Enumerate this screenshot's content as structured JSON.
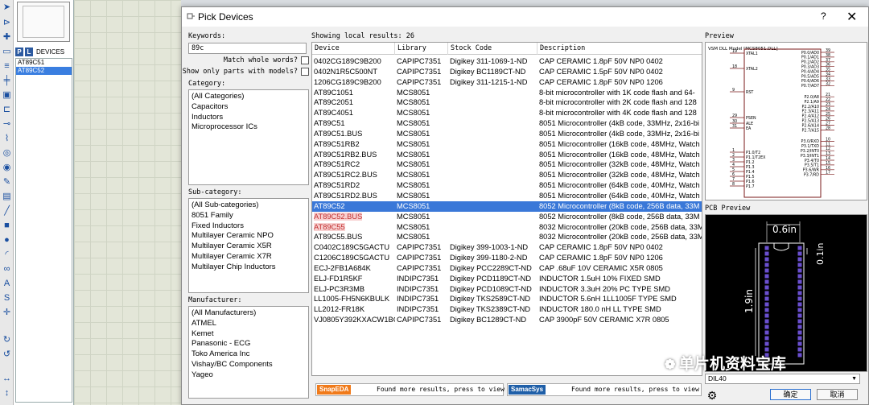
{
  "app": {
    "panel_tabs": [
      "P",
      "L"
    ],
    "devices_label": "DEVICES",
    "device_list": [
      {
        "name": "AT89C51",
        "selected": false
      },
      {
        "name": "AT89C52",
        "selected": true
      }
    ]
  },
  "dialog": {
    "title": "Pick Devices",
    "help": "?",
    "close": "✕",
    "keywords_label": "Keywords:",
    "keywords_value": "89c",
    "match_whole_words": "Match whole words?",
    "show_only_models": "Show only parts with models?",
    "category_label": "Category:",
    "categories": [
      "(All Categories)",
      "Capacitors",
      "Inductors",
      "Microprocessor ICs"
    ],
    "subcategory_label": "Sub-category:",
    "subcategories": [
      "(All Sub-categories)",
      "8051 Family",
      "Fixed Inductors",
      "Multilayer Ceramic NPO",
      "Multilayer Ceramic X5R",
      "Multilayer Ceramic X7R",
      "Multilayer Chip Inductors"
    ],
    "manufacturer_label": "Manufacturer:",
    "manufacturers": [
      "(All Manufacturers)",
      "ATMEL",
      "Kemet",
      "Panasonic - ECG",
      "Toko America Inc",
      "Vishay/BC Components",
      "Yageo"
    ],
    "results_summary": "Showing local results: 26",
    "columns": [
      "Device",
      "Library",
      "Stock Code",
      "Description"
    ],
    "results": [
      {
        "device": "0402CG189C9B200",
        "library": "CAPIPC7351",
        "stock": "Digikey 311-1069-1-ND",
        "desc": "CAP CERAMIC 1.8pF 50V NP0 0402"
      },
      {
        "device": "0402N1R5C500NT",
        "library": "CAPIPC7351",
        "stock": "Digikey BC1189CT-ND",
        "desc": "CAP CERAMIC 1.5pF 50V NP0 0402"
      },
      {
        "device": "1206CG189C9B200",
        "library": "CAPIPC7351",
        "stock": "Digikey 311-1215-1-ND",
        "desc": "CAP CERAMIC 1.8pF 50V NP0 1206"
      },
      {
        "device": "AT89C1051",
        "library": "MCS8051",
        "stock": "",
        "desc": "8-bit microcontroller with 1K code flash and 64-"
      },
      {
        "device": "AT89C2051",
        "library": "MCS8051",
        "stock": "",
        "desc": "8-bit microcontroller with 2K code flash and 128"
      },
      {
        "device": "AT89C4051",
        "library": "MCS8051",
        "stock": "",
        "desc": "8-bit microcontroller with 4K code flash and 128"
      },
      {
        "device": "AT89C51",
        "library": "MCS8051",
        "stock": "",
        "desc": "8051 Microcontroller (4kB code, 33MHz, 2x16-bi"
      },
      {
        "device": "AT89C51.BUS",
        "library": "MCS8051",
        "stock": "",
        "desc": "8051 Microcontroller (4kB code, 33MHz, 2x16-bi"
      },
      {
        "device": "AT89C51RB2",
        "library": "MCS8051",
        "stock": "",
        "desc": "8051 Microcontroller (16kB code, 48MHz, Watch"
      },
      {
        "device": "AT89C51RB2.BUS",
        "library": "MCS8051",
        "stock": "",
        "desc": "8051 Microcontroller (16kB code, 48MHz, Watch"
      },
      {
        "device": "AT89C51RC2",
        "library": "MCS8051",
        "stock": "",
        "desc": "8051 Microcontroller (32kB code, 48MHz, Watch"
      },
      {
        "device": "AT89C51RC2.BUS",
        "library": "MCS8051",
        "stock": "",
        "desc": "8051 Microcontroller (32kB code, 48MHz, Watch"
      },
      {
        "device": "AT89C51RD2",
        "library": "MCS8051",
        "stock": "",
        "desc": "8051 Microcontroller (64kB code, 40MHz, Watch"
      },
      {
        "device": "AT89C51RD2.BUS",
        "library": "MCS8051",
        "stock": "",
        "desc": "8051 Microcontroller (64kB code, 40MHz, Watch"
      },
      {
        "device": "AT89C52",
        "library": "MCS8051",
        "stock": "",
        "desc": "8052 Microcontroller (8kB code, 256B data, 33M",
        "selected": true
      },
      {
        "device": "AT89C52.BUS",
        "library": "MCS8051",
        "stock": "",
        "desc": "8052 Microcontroller (8kB code, 256B data, 33M",
        "highlight": true
      },
      {
        "device": "AT89C55",
        "library": "MCS8051",
        "stock": "",
        "desc": "8032 Microcontroller (20kB code, 256B data, 33M",
        "highlight": true
      },
      {
        "device": "AT89C55.BUS",
        "library": "MCS8051",
        "stock": "",
        "desc": "8032 Microcontroller (20kB code, 256B data, 33M"
      },
      {
        "device": "C0402C189C5GACTU",
        "library": "CAPIPC7351",
        "stock": "Digikey 399-1003-1-ND",
        "desc": "CAP CERAMIC 1.8pF 50V NP0 0402"
      },
      {
        "device": "C1206C189C5GACTU",
        "library": "CAPIPC7351",
        "stock": "Digikey 399-1180-2-ND",
        "desc": "CAP CERAMIC 1.8pF 50V NP0 1206"
      },
      {
        "device": "ECJ-2FB1A684K",
        "library": "CAPIPC7351",
        "stock": "Digikey PCC2289CT-ND",
        "desc": "CAP .68uF 10V CERAMIC X5R 0805"
      },
      {
        "device": "ELJ-FD1R5KF",
        "library": "INDIPC7351",
        "stock": "Digikey PCD1189CT-ND",
        "desc": "INDUCTOR 1.5uH 10% FIXED SMD"
      },
      {
        "device": "ELJ-PC3R3MB",
        "library": "INDIPC7351",
        "stock": "Digikey PCD1089CT-ND",
        "desc": "INDUCTOR 3.3uH 20% PC TYPE SMD"
      },
      {
        "device": "LL1005-FH5N6KBULK",
        "library": "INDIPC7351",
        "stock": "Digikey TKS2589CT-ND",
        "desc": "INDUCTOR 5.6nH 1LL1005F TYPE SMD"
      },
      {
        "device": "LL2012-FR18K",
        "library": "INDIPC7351",
        "stock": "Digikey TKS2389CT-ND",
        "desc": "INDUCTOR 180.0 nH LL TYPE SMD"
      },
      {
        "device": "VJ0805Y392KXACW1BC",
        "library": "CAPIPC7351",
        "stock": "Digikey BC1289CT-ND",
        "desc": "CAP 3900pF 50V CERAMIC X7R 0805"
      }
    ],
    "snapeda_logo": "SnapEDA",
    "snapeda_text": "Found more results, press to view",
    "samacsys_logo": "SamacSys",
    "samacsys_text": "Found more results, press to view",
    "preview_label": "Preview",
    "schematic_title": "VSM DLL Model [MCS8051.DLL]",
    "schematic_left_pins": [
      {
        "num": "19",
        "name": "XTAL1"
      },
      {
        "num": "18",
        "name": "XTAL2"
      },
      {
        "num": "9",
        "name": "RST"
      },
      {
        "num": "29",
        "name": "PSEN"
      },
      {
        "num": "30",
        "name": "ALE"
      },
      {
        "num": "31",
        "name": "EA"
      },
      {
        "num": "1",
        "name": "P1.0/T2"
      },
      {
        "num": "2",
        "name": "P1.1/T2EX"
      },
      {
        "num": "3",
        "name": "P1.2"
      },
      {
        "num": "4",
        "name": "P1.3"
      },
      {
        "num": "5",
        "name": "P1.4"
      },
      {
        "num": "6",
        "name": "P1.5"
      },
      {
        "num": "7",
        "name": "P1.6"
      },
      {
        "num": "8",
        "name": "P1.7"
      }
    ],
    "schematic_right_pins": [
      {
        "num": "39",
        "name": "P0.0/AD0"
      },
      {
        "num": "38",
        "name": "P0.1/AD1"
      },
      {
        "num": "37",
        "name": "P0.2/AD2"
      },
      {
        "num": "36",
        "name": "P0.3/AD3"
      },
      {
        "num": "35",
        "name": "P0.4/AD4"
      },
      {
        "num": "34",
        "name": "P0.5/AD5"
      },
      {
        "num": "33",
        "name": "P0.6/AD6"
      },
      {
        "num": "32",
        "name": "P0.7/AD7"
      },
      {
        "num": "21",
        "name": "P2.0/A8"
      },
      {
        "num": "22",
        "name": "P2.1/A9"
      },
      {
        "num": "23",
        "name": "P2.2/A10"
      },
      {
        "num": "24",
        "name": "P2.3/A11"
      },
      {
        "num": "25",
        "name": "P2.4/A12"
      },
      {
        "num": "26",
        "name": "P2.5/A13"
      },
      {
        "num": "27",
        "name": "P2.6/A14"
      },
      {
        "num": "28",
        "name": "P2.7/A15"
      },
      {
        "num": "10",
        "name": "P3.0/RXD"
      },
      {
        "num": "11",
        "name": "P3.1/TXD"
      },
      {
        "num": "12",
        "name": "P3.2/INT0"
      },
      {
        "num": "13",
        "name": "P3.3/INT1"
      },
      {
        "num": "14",
        "name": "P3.4/T0"
      },
      {
        "num": "15",
        "name": "P3.5/T1"
      },
      {
        "num": "16",
        "name": "P3.6/WR"
      },
      {
        "num": "17",
        "name": "P3.7/RD"
      }
    ],
    "pcb_preview_label": "PCB Preview",
    "pcb_width_label": "0.6in",
    "pcb_height_label": "1.9in",
    "pcb_pitch_label": "0.1in",
    "package_value": "DIL40",
    "ok_button": "确定",
    "cancel_button": "取消",
    "watermark": "单片机资料宝库"
  },
  "colors": {
    "selection": "#3a78d8",
    "highlight_text": "#c03030",
    "snapeda": "#f07a1a",
    "samacsys": "#1f5fa8",
    "pcb_pad": "#6a4fd0",
    "pcb_outline": "#ffffff"
  }
}
